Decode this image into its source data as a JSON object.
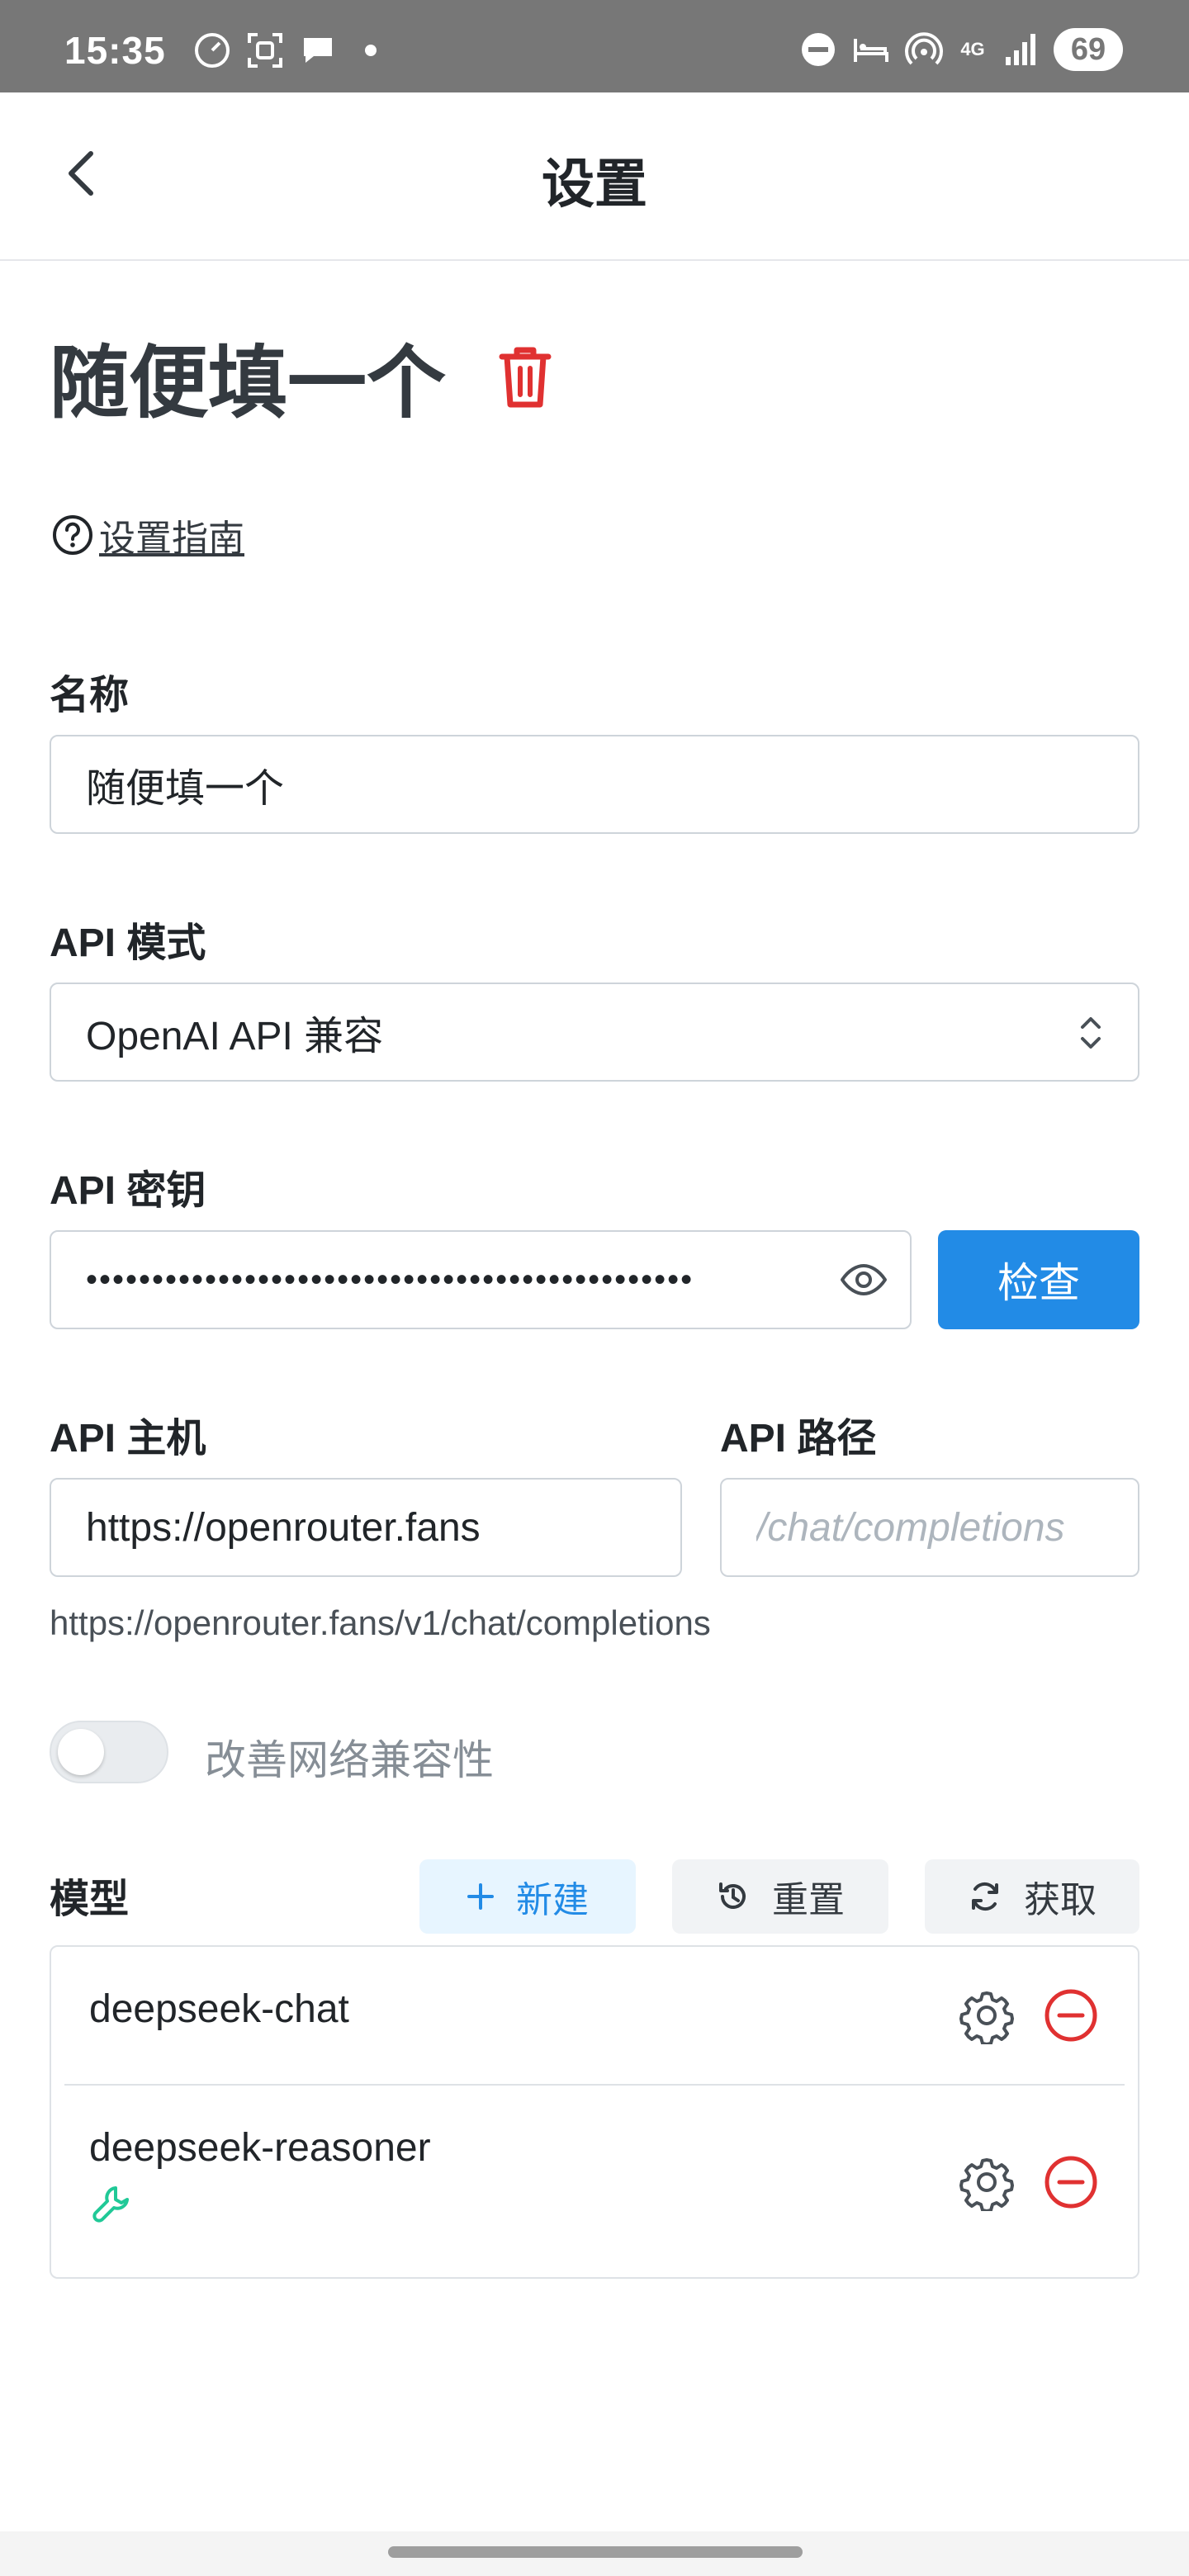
{
  "status_bar": {
    "time": "15:35",
    "left_icons": [
      "speedometer-icon",
      "face-scan-icon",
      "chat-bubble-icon",
      "dot-icon"
    ],
    "right_icons": [
      "dnd-icon",
      "bed-icon",
      "hotspot-icon",
      "network-4g-icon",
      "signal-icon"
    ],
    "network": "4G",
    "battery": "69"
  },
  "header": {
    "title": "设置"
  },
  "provider": {
    "name": "随便填一个"
  },
  "guide": {
    "label": "设置指南"
  },
  "form": {
    "name_label": "名称",
    "name_value": "随便填一个",
    "api_mode_label": "API 模式",
    "api_mode_value": "OpenAI API 兼容",
    "api_key_label": "API 密钥",
    "api_key_value": "••••••••••••••••••••••••••••••••••••••••••••••",
    "check_label": "检查",
    "api_host_label": "API 主机",
    "api_host_value": "https://openrouter.fans",
    "api_path_label": "API 路径",
    "api_path_placeholder": "/chat/completions",
    "endpoint_hint": "https://openrouter.fans/v1/chat/completions",
    "compat_toggle_label": "改善网络兼容性",
    "compat_toggle_on": false
  },
  "models": {
    "label": "模型",
    "new_label": "新建",
    "reset_label": "重置",
    "fetch_label": "获取",
    "items": [
      {
        "name": "deepseek-chat",
        "has_tool_icon": false
      },
      {
        "name": "deepseek-reasoner",
        "has_tool_icon": true
      }
    ]
  },
  "colors": {
    "primary": "#228be6",
    "danger": "#e03131",
    "tool": "#20c997",
    "statusbar": "#777777"
  }
}
